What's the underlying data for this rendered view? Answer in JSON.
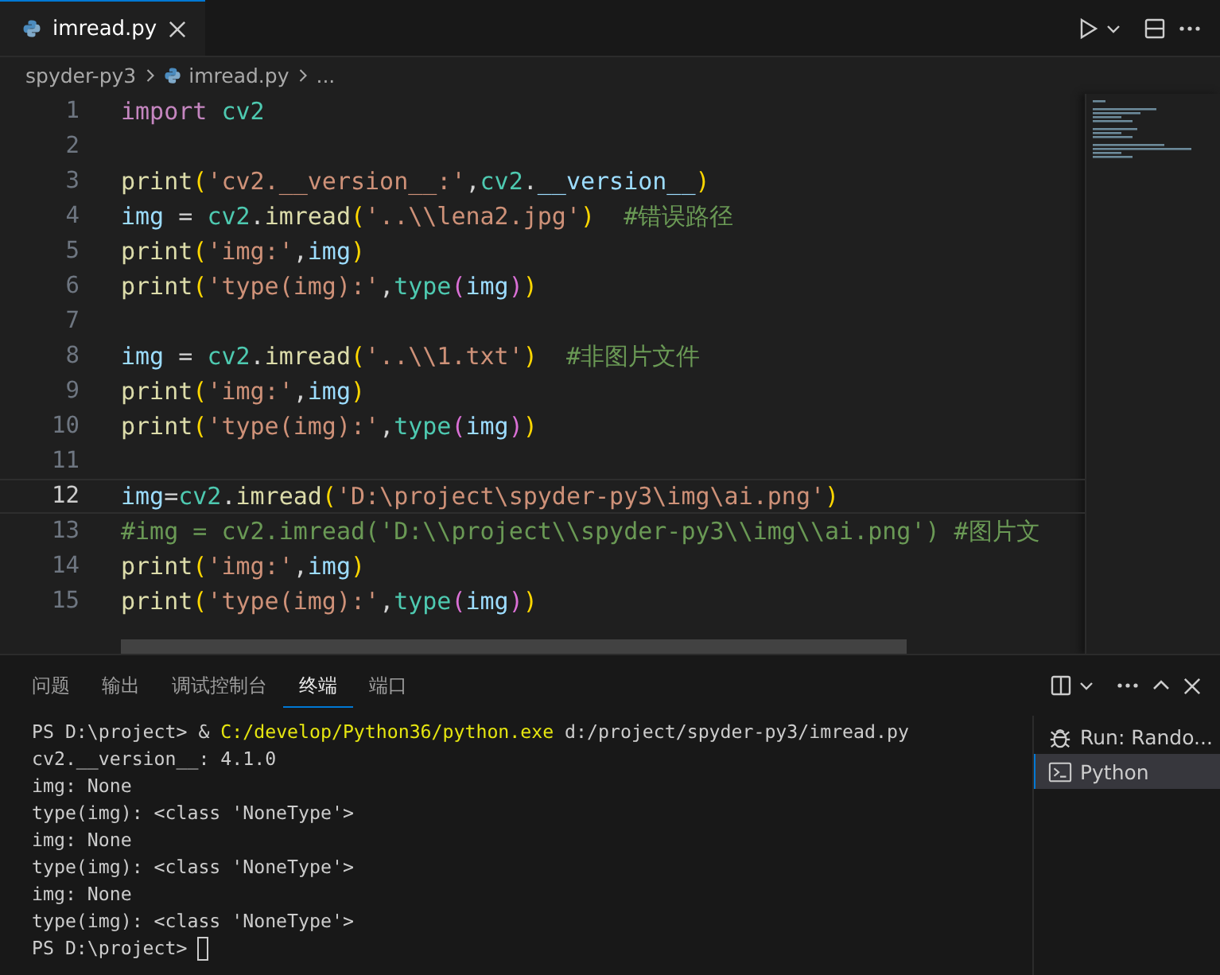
{
  "tabs": [
    {
      "label": "imread.py",
      "selected": true
    }
  ],
  "breadcrumb": [
    {
      "label": "spyder-py3",
      "kind": "folder"
    },
    {
      "label": "imread.py",
      "kind": "file"
    },
    {
      "label": "...",
      "kind": "more"
    }
  ],
  "editor": {
    "lines": [
      {
        "number": "1",
        "current": false,
        "tokens": [
          {
            "text": "import",
            "kind": "keyword"
          },
          {
            "text": " cv2",
            "kind": "module"
          }
        ]
      },
      {
        "number": "2",
        "current": false
      },
      {
        "number": "3",
        "current": false,
        "tokens": [
          {
            "text": "print",
            "kind": "function"
          },
          {
            "text": "(",
            "kind": "bracket"
          },
          {
            "text": "'cv2.__version__:'",
            "kind": "string"
          },
          {
            "text": ",",
            "kind": "operator"
          },
          {
            "text": "cv2",
            "kind": "module"
          },
          {
            "text": ".",
            "kind": "operator"
          },
          {
            "text": "__version__",
            "kind": "variable"
          },
          {
            "text": ")",
            "kind": "bracket"
          }
        ]
      },
      {
        "number": "4",
        "current": false,
        "tokens": [
          {
            "text": "img",
            "kind": "variable"
          },
          {
            "text": " = ",
            "kind": "operator"
          },
          {
            "text": "cv2",
            "kind": "module"
          },
          {
            "text": ".",
            "kind": "operator"
          },
          {
            "text": "imread",
            "kind": "function"
          },
          {
            "text": "(",
            "kind": "bracket"
          },
          {
            "text": "'..\\\\lena2.jpg'",
            "kind": "string"
          },
          {
            "text": ")",
            "kind": "bracket"
          },
          {
            "text": "  #错误路径",
            "kind": "comment"
          }
        ]
      },
      {
        "number": "5",
        "current": false,
        "tokens": [
          {
            "text": "print",
            "kind": "function"
          },
          {
            "text": "(",
            "kind": "bracket"
          },
          {
            "text": "'img:'",
            "kind": "string"
          },
          {
            "text": ",",
            "kind": "operator"
          },
          {
            "text": "img",
            "kind": "variable"
          },
          {
            "text": ")",
            "kind": "bracket"
          }
        ]
      },
      {
        "number": "6",
        "current": false,
        "tokens": [
          {
            "text": "print",
            "kind": "function"
          },
          {
            "text": "(",
            "kind": "bracket"
          },
          {
            "text": "'type(img):'",
            "kind": "string"
          },
          {
            "text": ",",
            "kind": "operator"
          },
          {
            "text": "type",
            "kind": "module"
          },
          {
            "text": "(",
            "kind": "inner-bracket"
          },
          {
            "text": "img",
            "kind": "variable"
          },
          {
            "text": ")",
            "kind": "inner-bracket"
          },
          {
            "text": ")",
            "kind": "bracket"
          }
        ]
      },
      {
        "number": "7",
        "current": false
      },
      {
        "number": "8",
        "current": false,
        "tokens": [
          {
            "text": "img",
            "kind": "variable"
          },
          {
            "text": " = ",
            "kind": "operator"
          },
          {
            "text": "cv2",
            "kind": "module"
          },
          {
            "text": ".",
            "kind": "operator"
          },
          {
            "text": "imread",
            "kind": "function"
          },
          {
            "text": "(",
            "kind": "bracket"
          },
          {
            "text": "'..\\\\1.txt'",
            "kind": "string"
          },
          {
            "text": ")",
            "kind": "bracket"
          },
          {
            "text": "  #非图片文件",
            "kind": "comment"
          }
        ]
      },
      {
        "number": "9",
        "current": false,
        "tokens": [
          {
            "text": "print",
            "kind": "function"
          },
          {
            "text": "(",
            "kind": "bracket"
          },
          {
            "text": "'img:'",
            "kind": "string"
          },
          {
            "text": ",",
            "kind": "operator"
          },
          {
            "text": "img",
            "kind": "variable"
          },
          {
            "text": ")",
            "kind": "bracket"
          }
        ]
      },
      {
        "number": "10",
        "current": false,
        "tokens": [
          {
            "text": "print",
            "kind": "function"
          },
          {
            "text": "(",
            "kind": "bracket"
          },
          {
            "text": "'type(img):'",
            "kind": "string"
          },
          {
            "text": ",",
            "kind": "operator"
          },
          {
            "text": "type",
            "kind": "module"
          },
          {
            "text": "(",
            "kind": "inner-bracket"
          },
          {
            "text": "img",
            "kind": "variable"
          },
          {
            "text": ")",
            "kind": "inner-bracket"
          },
          {
            "text": ")",
            "kind": "bracket"
          }
        ]
      },
      {
        "number": "11",
        "current": false
      },
      {
        "number": "12",
        "current": true,
        "tokens": [
          {
            "text": "img",
            "kind": "variable"
          },
          {
            "text": "=",
            "kind": "operator"
          },
          {
            "text": "cv2",
            "kind": "module"
          },
          {
            "text": ".",
            "kind": "operator"
          },
          {
            "text": "imread",
            "kind": "function"
          },
          {
            "text": "(",
            "kind": "bracket"
          },
          {
            "text": "'D:\\project\\spyder-py3\\img\\ai.png'",
            "kind": "string"
          },
          {
            "text": ")",
            "kind": "bracket"
          }
        ]
      },
      {
        "number": "13",
        "current": false,
        "tokens": [
          {
            "text": "#img = cv2.imread('D:\\\\project\\\\spyder-py3\\\\img\\\\ai.png') #图片文",
            "kind": "comment"
          }
        ]
      },
      {
        "number": "14",
        "current": false,
        "tokens": [
          {
            "text": "print",
            "kind": "function"
          },
          {
            "text": "(",
            "kind": "bracket"
          },
          {
            "text": "'img:'",
            "kind": "string"
          },
          {
            "text": ",",
            "kind": "operator"
          },
          {
            "text": "img",
            "kind": "variable"
          },
          {
            "text": ")",
            "kind": "bracket"
          }
        ]
      },
      {
        "number": "15",
        "current": false,
        "tokens": [
          {
            "text": "print",
            "kind": "function"
          },
          {
            "text": "(",
            "kind": "bracket"
          },
          {
            "text": "'type(img):'",
            "kind": "string"
          },
          {
            "text": ",",
            "kind": "operator"
          },
          {
            "text": "type",
            "kind": "module"
          },
          {
            "text": "(",
            "kind": "inner-bracket"
          },
          {
            "text": "img",
            "kind": "variable"
          },
          {
            "text": ")",
            "kind": "inner-bracket"
          },
          {
            "text": ")",
            "kind": "bracket"
          }
        ]
      }
    ]
  },
  "panel": {
    "tabs": [
      {
        "label": "问题",
        "selected": false
      },
      {
        "label": "输出",
        "selected": false
      },
      {
        "label": "调试控制台",
        "selected": false
      },
      {
        "label": "终端",
        "selected": true
      },
      {
        "label": "端口",
        "selected": false
      }
    ],
    "terminal": {
      "lines": [
        [
          {
            "text": "PS D:\\project> & ",
            "kind": "output"
          },
          {
            "text": "C:/develop/Python36/python.exe",
            "kind": "command"
          },
          {
            "text": " d:/project/spyder-py3/imread.py",
            "kind": "output"
          }
        ],
        [
          {
            "text": "cv2.__version__: 4.1.0",
            "kind": "output"
          }
        ],
        [
          {
            "text": "img: None",
            "kind": "output"
          }
        ],
        [
          {
            "text": "type(img): <class 'NoneType'>",
            "kind": "output"
          }
        ],
        [
          {
            "text": "img: None",
            "kind": "output"
          }
        ],
        [
          {
            "text": "type(img): <class 'NoneType'>",
            "kind": "output"
          }
        ],
        [
          {
            "text": "img: None",
            "kind": "output"
          }
        ],
        [
          {
            "text": "type(img): <class 'NoneType'>",
            "kind": "output"
          }
        ]
      ],
      "prompt": "PS D:\\project>"
    },
    "sessions": [
      {
        "label": "Run: Rando...",
        "kind": "debug",
        "selected": false
      },
      {
        "label": "Python",
        "kind": "shell",
        "selected": true
      }
    ]
  }
}
